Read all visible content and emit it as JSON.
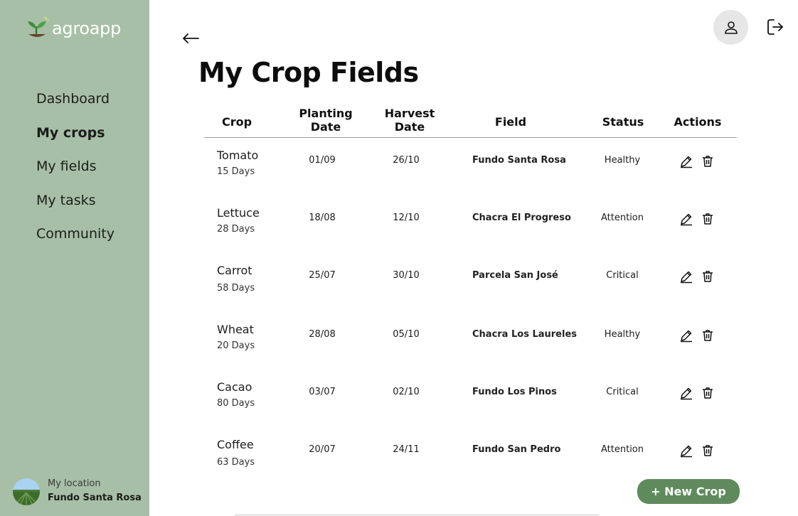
{
  "app": {
    "name": "agroapp",
    "brand_color": "#a7bfa6",
    "accent_color": "#5f8a5d"
  },
  "sidebar": {
    "items": [
      {
        "label": "Dashboard",
        "active": false
      },
      {
        "label": "My crops",
        "active": true
      },
      {
        "label": "My fields",
        "active": false
      },
      {
        "label": "My tasks",
        "active": false
      },
      {
        "label": "Community",
        "active": false
      }
    ],
    "location": {
      "label": "My location",
      "value": "Fundo Santa Rosa"
    }
  },
  "header": {
    "back_icon": "arrow-left-icon",
    "user_icon": "user-icon",
    "logout_icon": "logout-icon"
  },
  "main": {
    "title": "My Crop Fields",
    "columns": {
      "crop": "Crop",
      "planting_1": "Planting",
      "planting_2": "Date",
      "harvest_1": "Harvest",
      "harvest_2": "Date",
      "field": "Field",
      "status": "Status",
      "actions": "Actions"
    },
    "rows": [
      {
        "crop": "Tomato",
        "days": "15 Days",
        "planting": "01/09",
        "harvest": "26/10",
        "field": "Fundo Santa Rosa",
        "status": "Healthy"
      },
      {
        "crop": "Lettuce",
        "days": "28 Days",
        "planting": "18/08",
        "harvest": "12/10",
        "field": "Chacra El Progreso",
        "status": "Attention"
      },
      {
        "crop": "Carrot",
        "days": "58 Days",
        "planting": "25/07",
        "harvest": "30/10",
        "field": "Parcela San José",
        "status": "Critical"
      },
      {
        "crop": "Wheat",
        "days": "20 Days",
        "planting": "28/08",
        "harvest": "05/10",
        "field": "Chacra Los Laureles",
        "status": "Healthy"
      },
      {
        "crop": "Cacao",
        "days": "80 Days",
        "planting": "03/07",
        "harvest": "02/10",
        "field": "Fundo Los Pinos",
        "status": "Critical"
      },
      {
        "crop": "Coffee",
        "days": "63 Days",
        "planting": "20/07",
        "harvest": "24/11",
        "field": "Fundo San Pedro",
        "status": "Attention"
      }
    ],
    "new_button": "+ New Crop"
  }
}
